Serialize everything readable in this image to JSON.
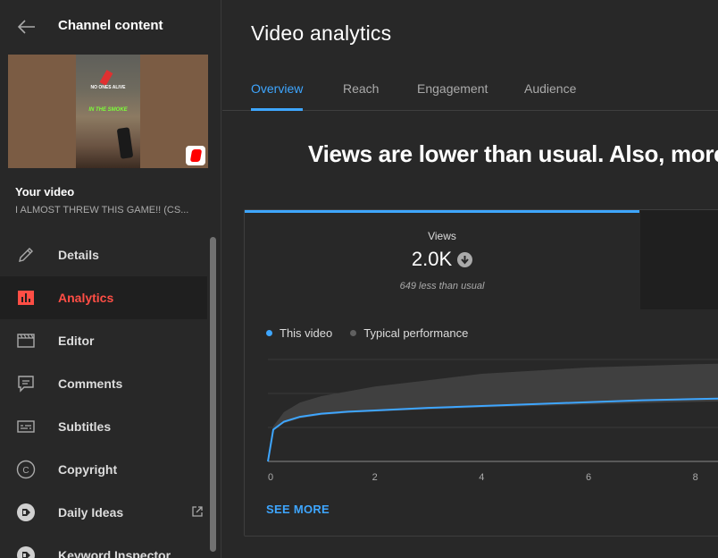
{
  "sidebar": {
    "title": "Channel content",
    "thumbnail": {
      "top_text": "NO ONES ALIVE",
      "bottom_text": "IN THE SMOKE"
    },
    "your_video_label": "Your video",
    "video_name": "I ALMOST THREW THIS GAME!! (CS...",
    "items": [
      {
        "label": "Details",
        "icon": "pencil-icon",
        "active": false
      },
      {
        "label": "Analytics",
        "icon": "analytics-icon",
        "active": true
      },
      {
        "label": "Editor",
        "icon": "editor-icon",
        "active": false
      },
      {
        "label": "Comments",
        "icon": "comments-icon",
        "active": false
      },
      {
        "label": "Subtitles",
        "icon": "subtitles-icon",
        "active": false
      },
      {
        "label": "Copyright",
        "icon": "copyright-icon",
        "active": false
      },
      {
        "label": "Daily Ideas",
        "icon": "daily-ideas-icon",
        "active": false,
        "external": true
      },
      {
        "label": "Keyword Inspector",
        "icon": "keyword-inspector-icon",
        "active": false
      }
    ]
  },
  "main": {
    "title": "Video analytics",
    "tabs": [
      {
        "label": "Overview",
        "active": true
      },
      {
        "label": "Reach",
        "active": false
      },
      {
        "label": "Engagement",
        "active": false
      },
      {
        "label": "Audience",
        "active": false
      }
    ],
    "headline": "Views are lower than usual. Also, more",
    "metric": {
      "label": "Views",
      "value": "2.0K",
      "trend": "down",
      "comparison": "649 less than usual"
    },
    "legend": [
      {
        "label": "This video",
        "color": "#3ea6ff"
      },
      {
        "label": "Typical performance",
        "color": "#606060"
      }
    ],
    "see_more": "SEE MORE"
  },
  "chart_data": {
    "type": "area",
    "x_ticks": [
      "0",
      "2",
      "4",
      "6",
      "8"
    ],
    "xlim": [
      0,
      9.2
    ],
    "ylim": [
      0,
      3200
    ],
    "series": [
      {
        "name": "This video",
        "kind": "line",
        "color": "#3ea6ff",
        "x": [
          0,
          0.1,
          0.3,
          0.6,
          1.0,
          1.5,
          2.0,
          3.0,
          4.0,
          5.0,
          6.0,
          7.0,
          8.0,
          9.2
        ],
        "y": [
          0,
          1000,
          1250,
          1400,
          1500,
          1560,
          1600,
          1680,
          1740,
          1800,
          1860,
          1920,
          1960,
          2000
        ]
      },
      {
        "name": "Typical performance",
        "kind": "band",
        "color": "#404040",
        "x": [
          0,
          0.1,
          0.3,
          0.6,
          1.0,
          1.5,
          2.0,
          3.0,
          4.0,
          5.0,
          6.0,
          7.0,
          8.0,
          9.2
        ],
        "lower": [
          0,
          1000,
          1200,
          1350,
          1450,
          1520,
          1560,
          1630,
          1690,
          1740,
          1790,
          1830,
          1870,
          1900
        ],
        "upper": [
          0,
          1100,
          1550,
          1850,
          2050,
          2200,
          2350,
          2550,
          2750,
          2850,
          2950,
          3000,
          3050,
          3100
        ]
      }
    ],
    "grid": true
  }
}
